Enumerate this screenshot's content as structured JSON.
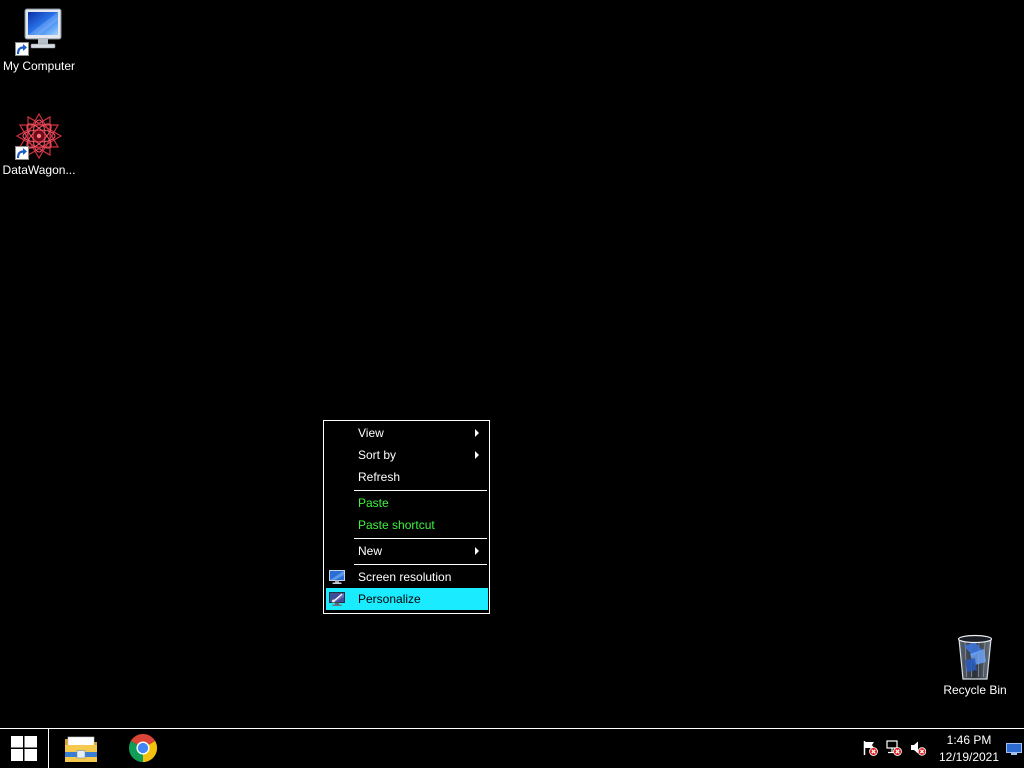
{
  "desktop": {
    "background_color": "#000000",
    "icons": [
      {
        "label": "My Computer",
        "icon": "my-computer-icon",
        "overlay": "shortcut-arrow-icon"
      },
      {
        "label": "DataWagon...",
        "icon": "datawagon-icon",
        "overlay": "shortcut-arrow-icon"
      },
      {
        "label": "Recycle Bin",
        "icon": "recycle-bin-icon"
      }
    ]
  },
  "context_menu": {
    "sections": [
      {
        "items": [
          {
            "label": "View",
            "submenu": true
          },
          {
            "label": "Sort by",
            "submenu": true
          },
          {
            "label": "Refresh",
            "submenu": false
          }
        ]
      },
      {
        "items": [
          {
            "label": "Paste",
            "disabled": true
          },
          {
            "label": "Paste shortcut",
            "disabled": true
          }
        ]
      },
      {
        "items": [
          {
            "label": "New",
            "submenu": true
          }
        ]
      },
      {
        "items": [
          {
            "label": "Screen resolution",
            "icon": "screen-resolution-icon"
          },
          {
            "label": "Personalize",
            "icon": "personalize-icon",
            "highlighted": true
          }
        ]
      }
    ]
  },
  "taskbar": {
    "start_button": {
      "icon": "windows-logo-icon"
    },
    "pinned_apps": [
      {
        "icon": "file-explorer-icon"
      },
      {
        "icon": "chrome-icon"
      }
    ],
    "system_tray": [
      {
        "icon": "action-center-flag-icon",
        "badge": "red-x-badge-icon"
      },
      {
        "icon": "network-icon",
        "badge": "red-x-badge-icon"
      },
      {
        "icon": "volume-muted-icon",
        "badge": "red-x-badge-icon"
      }
    ],
    "clock": {
      "time": "1:46 PM",
      "date": "12/19/2021"
    },
    "show_desktop": {
      "icon": "show-desktop-icon"
    }
  },
  "theme": {
    "text_color": "#ffffff",
    "disabled_text_color": "#3ff23f",
    "highlight_color": "#1aebff",
    "highlight_text_color": "#000000",
    "border_color": "#ffffff"
  }
}
